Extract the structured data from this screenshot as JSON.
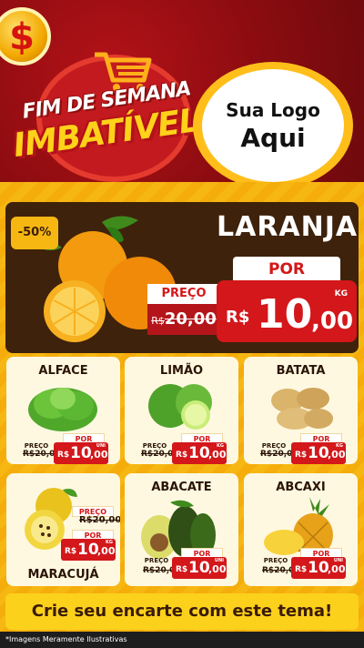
{
  "header": {
    "coin_symbol": "$",
    "title_line1": "FIM DE SEMANA",
    "title_line2": "IMBATÍVEL",
    "logo_line1": "Sua Logo",
    "logo_line2": "Aqui"
  },
  "hero": {
    "discount": "-50%",
    "product": "LARANJA",
    "por_label": "POR",
    "preco_label": "PREÇO",
    "old_currency": "R$",
    "old_price": "20,00",
    "currency": "R$",
    "price_int": "10",
    "price_dec": ",00",
    "unit": "KG"
  },
  "products": [
    {
      "name": "ALFACE",
      "preco_label": "PREÇO",
      "old_price": "R$20,00",
      "por_label": "POR",
      "currency": "R$",
      "price_int": "10",
      "price_dec": ",00",
      "unit": "UNI"
    },
    {
      "name": "LIMÃO",
      "preco_label": "PREÇO",
      "old_price": "R$20,00",
      "por_label": "POR",
      "currency": "R$",
      "price_int": "10",
      "price_dec": ",00",
      "unit": "KG"
    },
    {
      "name": "BATATA",
      "preco_label": "PREÇO",
      "old_price": "R$20,00",
      "por_label": "POR",
      "currency": "R$",
      "price_int": "10",
      "price_dec": ",00",
      "unit": "KG"
    },
    {
      "name": "MARACUJÁ",
      "preco_label": "PREÇO",
      "old_price": "R$20,00",
      "por_label": "POR",
      "currency": "R$",
      "price_int": "10",
      "price_dec": ",00",
      "unit": "KG"
    },
    {
      "name": "ABACATE",
      "preco_label": "PREÇO",
      "old_price": "R$20,00",
      "por_label": "POR",
      "currency": "R$",
      "price_int": "10",
      "price_dec": ",00",
      "unit": "UNI"
    },
    {
      "name": "ABCAXI",
      "preco_label": "PREÇO",
      "old_price": "R$20,00",
      "por_label": "POR",
      "currency": "R$",
      "price_int": "10",
      "price_dec": ",00",
      "unit": "UNI"
    }
  ],
  "cta": "Crie seu encarte com este tema!",
  "footer": "*Imagens Meramente Ilustrativas",
  "colors": {
    "red": "#d3171a",
    "yellow": "#f7b713",
    "dark_brown": "#3e220c"
  }
}
